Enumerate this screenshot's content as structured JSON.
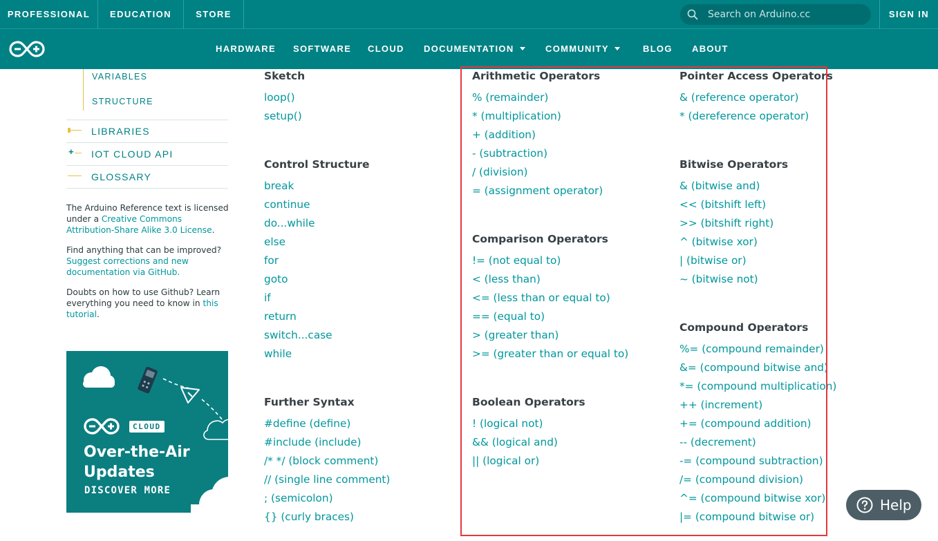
{
  "topbar": {
    "links": [
      "PROFESSIONAL",
      "EDUCATION",
      "STORE"
    ],
    "search_placeholder": "Search on Arduino.cc",
    "sign_in": "SIGN IN"
  },
  "nav": {
    "hardware": "HARDWARE",
    "software": "SOFTWARE",
    "cloud": "CLOUD",
    "documentation": "DOCUMENTATION",
    "community": "COMMUNITY",
    "blog": "BLOG",
    "about": "ABOUT"
  },
  "sidebar": {
    "subitems": [
      "VARIABLES",
      "STRUCTURE"
    ],
    "items": [
      "LIBRARIES",
      "IOT CLOUD API",
      "GLOSSARY"
    ],
    "license": {
      "p1_text": "The Arduino Reference text is licensed under a ",
      "p1_link": "Creative Commons Attribution-Share Alike 3.0 License",
      "p1_end": ".",
      "p2_text": "Find anything that can be improved? ",
      "p2_link": "Suggest corrections and new documentation via GitHub.",
      "p3_text": "Doubts on how to use Github? Learn everything you need to know in ",
      "p3_link": "this tutorial",
      "p3_end": "."
    },
    "promo": {
      "tag": "CLOUD",
      "title_line1": "Over-the-Air",
      "title_line2": "Updates",
      "cta": "DISCOVER MORE"
    }
  },
  "reference": {
    "sketch": {
      "title": "Sketch",
      "items": [
        "loop()",
        "setup()"
      ]
    },
    "control_structure": {
      "title": "Control Structure",
      "items": [
        "break",
        "continue",
        "do...while",
        "else",
        "for",
        "goto",
        "if",
        "return",
        "switch...case",
        "while"
      ]
    },
    "further_syntax": {
      "title": "Further Syntax",
      "items": [
        "#define (define)",
        "#include (include)",
        "/* */ (block comment)",
        "// (single line comment)",
        "; (semicolon)",
        "{} (curly braces)"
      ]
    },
    "arithmetic": {
      "title": "Arithmetic Operators",
      "items": [
        "% (remainder)",
        "* (multiplication)",
        "+ (addition)",
        "- (subtraction)",
        "/ (division)",
        "= (assignment operator)"
      ]
    },
    "comparison": {
      "title": "Comparison Operators",
      "items": [
        "!= (not equal to)",
        "< (less than)",
        "<= (less than or equal to)",
        "== (equal to)",
        "> (greater than)",
        ">= (greater than or equal to)"
      ]
    },
    "boolean": {
      "title": "Boolean Operators",
      "items": [
        "! (logical not)",
        "&& (logical and)",
        "|| (logical or)"
      ]
    },
    "pointer": {
      "title": "Pointer Access Operators",
      "items": [
        "& (reference operator)",
        "* (dereference operator)"
      ]
    },
    "bitwise": {
      "title": "Bitwise Operators",
      "items": [
        "& (bitwise and)",
        "<< (bitshift left)",
        ">> (bitshift right)",
        "^ (bitwise xor)",
        "| (bitwise or)",
        "~ (bitwise not)"
      ]
    },
    "compound": {
      "title": "Compound Operators",
      "items": [
        "%= (compound remainder)",
        "&= (compound bitwise and)",
        "*= (compound multiplication)",
        "++ (increment)",
        "+= (compound addition)",
        "-- (decrement)",
        "-= (compound subtraction)",
        "/= (compound division)",
        "^= (compound bitwise xor)",
        "|= (compound bitwise or)"
      ]
    }
  },
  "help": {
    "label": "Help"
  },
  "colors": {
    "brand_teal": "#008184",
    "link_teal": "#00979d",
    "accent_yellow": "#e2c244",
    "highlight_red": "#e2383f"
  },
  "icons": [
    "search-icon",
    "arduino-logo-icon",
    "chevron-down-icon",
    "question-circle-icon",
    "cloud-icon",
    "paper-plane-icon"
  ]
}
